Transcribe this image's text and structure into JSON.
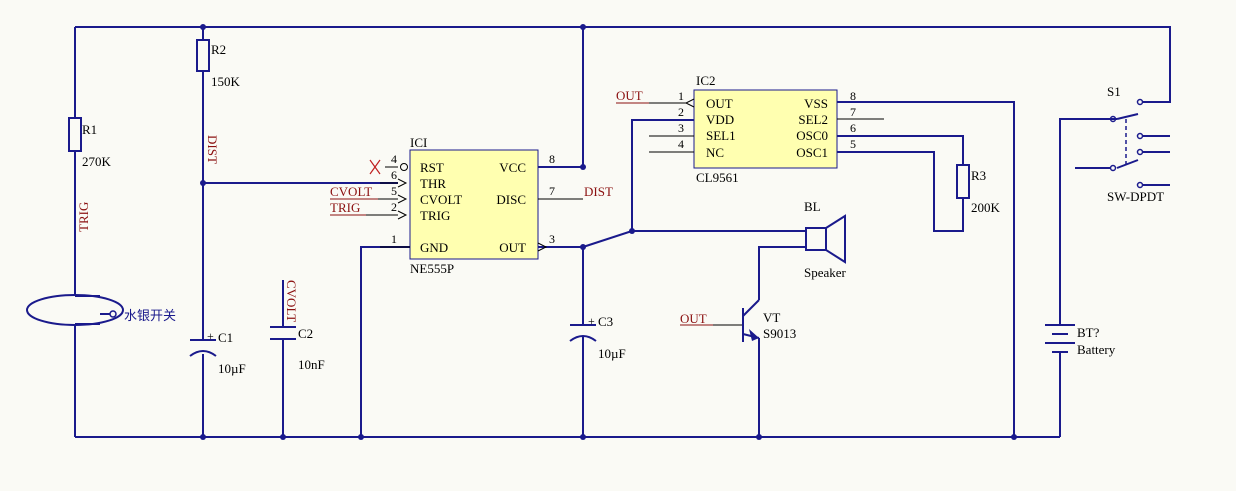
{
  "components": {
    "r1": {
      "ref": "R1",
      "value": "270K"
    },
    "r2": {
      "ref": "R2",
      "value": "150K"
    },
    "r3": {
      "ref": "R3",
      "value": "200K"
    },
    "c1": {
      "ref": "C1",
      "value": "10µF"
    },
    "c2": {
      "ref": "C2",
      "value": "10nF"
    },
    "c3": {
      "ref": "C3",
      "value": "10µF"
    },
    "ic1": {
      "ref": "ICI",
      "part": "NE555P",
      "pins": {
        "rst": "RST",
        "thr": "THR",
        "cvolt": "CVOLT",
        "trig": "TRIG",
        "gnd": "GND",
        "vcc": "VCC",
        "disc": "DISC",
        "out": "OUT"
      },
      "pin_numbers": {
        "rst": "4",
        "thr": "6",
        "cvolt": "5",
        "trig": "2",
        "gnd": "1",
        "vcc": "8",
        "disc": "7",
        "out": "3"
      }
    },
    "ic2": {
      "ref": "IC2",
      "part": "CL9561",
      "pins": {
        "out": "OUT",
        "vdd": "VDD",
        "sel1": "SEL1",
        "nc": "NC",
        "vss": "VSS",
        "sel2": "SEL2",
        "osc0": "OSC0",
        "osc1": "OSC1"
      },
      "pin_numbers": {
        "out": "1",
        "vdd": "2",
        "sel1": "3",
        "nc": "4",
        "vss": "8",
        "sel2": "7",
        "osc0": "6",
        "osc1": "5"
      }
    },
    "speaker": {
      "ref": "BL",
      "label": "Speaker"
    },
    "transistor": {
      "ref": "VT",
      "part": "S9013"
    },
    "switch": {
      "ref": "S1",
      "type": "SW-DPDT"
    },
    "battery": {
      "ref": "BT?",
      "label": "Battery"
    },
    "mercury_switch": {
      "label": "水银开关"
    }
  },
  "net_labels": {
    "trig_vertical": "TRIG",
    "dist_vertical": "DIST",
    "cvolt_vertical": "CVOLT",
    "cvolt_in": "CVOLT",
    "trig_in": "TRIG",
    "dist_out": "DIST",
    "out_ic2": "OUT",
    "out_vt": "OUT"
  },
  "colors": {
    "wire": "#1a1a8c",
    "chip_fill": "#ffffb0",
    "net_label": "#8b1010",
    "background": "#fafaf5"
  }
}
